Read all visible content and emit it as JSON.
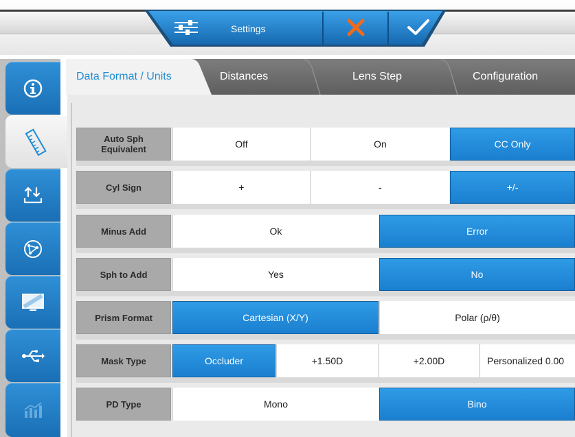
{
  "header": {
    "settings_label": "Settings",
    "settings_icon": "sliders-icon",
    "cancel_icon": "close-icon",
    "confirm_icon": "check-icon"
  },
  "sidebar": {
    "items": [
      {
        "icon": "info-icon"
      },
      {
        "icon": "ruler-icon",
        "active": true
      },
      {
        "icon": "transfer-icon"
      },
      {
        "icon": "network-icon"
      },
      {
        "icon": "monitor-icon"
      },
      {
        "icon": "usb-icon"
      },
      {
        "icon": "chart-icon"
      }
    ]
  },
  "tabs": [
    {
      "label": "Data Format / Units",
      "active": true
    },
    {
      "label": "Distances"
    },
    {
      "label": "Lens Step"
    },
    {
      "label": "Configuration"
    }
  ],
  "rows": [
    {
      "label": "Auto Sph Equivalent",
      "options": [
        {
          "text": "Off"
        },
        {
          "text": "On"
        },
        {
          "text": "CC Only",
          "selected": true
        }
      ]
    },
    {
      "label": "Cyl Sign",
      "options": [
        {
          "text": "+"
        },
        {
          "text": "-"
        },
        {
          "text": "+/-",
          "selected": true
        }
      ]
    },
    {
      "label": "Minus Add",
      "options": [
        {
          "text": "Ok"
        },
        {
          "text": "Error",
          "selected": true
        }
      ]
    },
    {
      "label": "Sph to Add",
      "options": [
        {
          "text": "Yes"
        },
        {
          "text": "No",
          "selected": true
        }
      ]
    },
    {
      "label": "Prism Format",
      "options": [
        {
          "text": "Cartesian (X/Y)",
          "selected": true
        },
        {
          "text": "Polar (ρ/θ)"
        }
      ]
    },
    {
      "label": "Mask Type",
      "options": [
        {
          "text": "Occluder",
          "selected": true
        },
        {
          "text": "+1.50D"
        },
        {
          "text": "+2.00D"
        },
        {
          "text": "Personalized 0.00"
        }
      ]
    },
    {
      "label": "PD Type",
      "options": [
        {
          "text": "Mono"
        },
        {
          "text": "Bino",
          "selected": true
        }
      ]
    }
  ],
  "colors": {
    "accent": "#1e8bd3",
    "selected_bg": "#2a93df",
    "cancel": "#f06a1d",
    "label_bg": "#a9a9a9"
  }
}
